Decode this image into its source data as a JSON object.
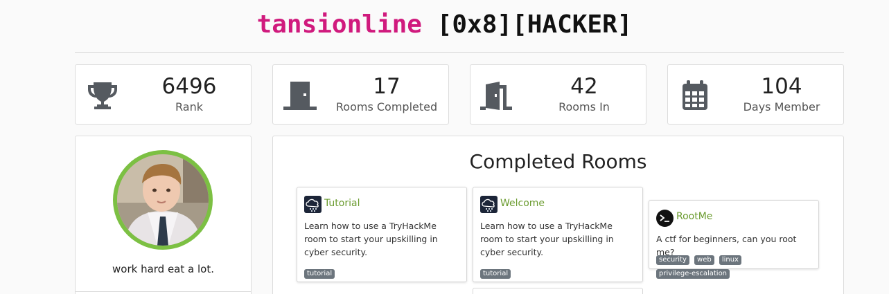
{
  "header": {
    "username": "tansionline",
    "rank_tag": "[0x8][HACKER]"
  },
  "stats": [
    {
      "value": "6496",
      "label": "Rank",
      "icon": "trophy-icon"
    },
    {
      "value": "17",
      "label": "Rooms Completed",
      "icon": "door-closed-icon"
    },
    {
      "value": "42",
      "label": "Rooms In",
      "icon": "door-open-icon"
    },
    {
      "value": "104",
      "label": "Days Member",
      "icon": "calendar-icon"
    }
  ],
  "profile": {
    "bio": "work hard eat a lot."
  },
  "completed_rooms": {
    "title": "Completed Rooms",
    "rooms": [
      {
        "title": "Tutorial",
        "description": "Learn how to use a TryHackMe room to start your upskilling in cyber security.",
        "tags": [
          "tutorial"
        ],
        "icon": "cloud-tryhackme-icon"
      },
      {
        "title": "Welcome",
        "description": "Learn how to use a TryHackMe room to start your upskilling in cyber security.",
        "tags": [
          "tutorial"
        ],
        "icon": "cloud-tryhackme-icon"
      },
      {
        "title": "RootMe",
        "description": "A ctf for beginners, can you root me?",
        "tags": [
          "security",
          "web",
          "linux",
          "privilege-escalation"
        ],
        "icon": "terminal-icon"
      }
    ]
  },
  "colors": {
    "username": "#d01a7d",
    "avatar_ring": "#7cc043",
    "room_title": "#6a9b2e",
    "icon_gray": "#555a60"
  }
}
